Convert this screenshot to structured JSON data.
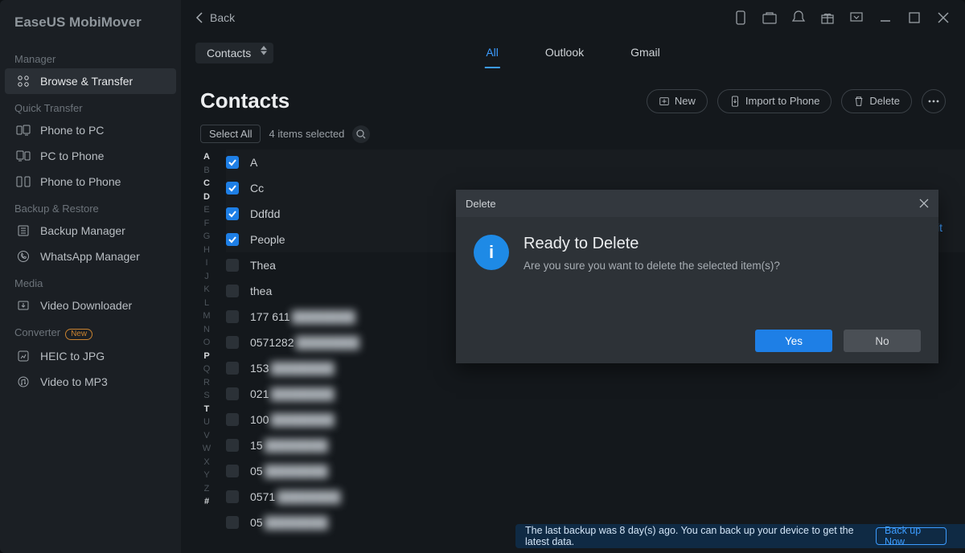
{
  "logo": "EaseUS MobiMover",
  "sidebar_sections": [
    {
      "title": "Manager",
      "items": [
        {
          "icon": "grid",
          "label": "Browse & Transfer",
          "active": true
        }
      ]
    },
    {
      "title": "Quick Transfer",
      "items": [
        {
          "icon": "phone-pc",
          "label": "Phone to PC"
        },
        {
          "icon": "pc-phone",
          "label": "PC to Phone"
        },
        {
          "icon": "phone-phone",
          "label": "Phone to Phone"
        }
      ]
    },
    {
      "title": "Backup & Restore",
      "items": [
        {
          "icon": "backup",
          "label": "Backup Manager"
        },
        {
          "icon": "whatsapp",
          "label": "WhatsApp Manager"
        }
      ]
    },
    {
      "title": "Media",
      "items": [
        {
          "icon": "download",
          "label": "Video Downloader"
        }
      ]
    },
    {
      "title": "Converter",
      "badge": "New",
      "items": [
        {
          "icon": "heic",
          "label": "HEIC to JPG"
        },
        {
          "icon": "mp3",
          "label": "Video to MP3"
        }
      ]
    }
  ],
  "back_label": "Back",
  "category_select": "Contacts",
  "tabs": [
    {
      "label": "All",
      "active": true
    },
    {
      "label": "Outlook"
    },
    {
      "label": "Gmail"
    }
  ],
  "page_title": "Contacts",
  "header_buttons": {
    "new": "New",
    "import": "Import to Phone",
    "delete": "Delete"
  },
  "select_all": "Select All",
  "selected_count": "4 items selected",
  "edit_label": "Edit",
  "contacts": [
    {
      "name": "A",
      "checked": true
    },
    {
      "name": "Cc",
      "checked": true
    },
    {
      "name": "Ddfdd",
      "checked": true
    },
    {
      "name": "People",
      "checked": true
    },
    {
      "name": "Thea",
      "checked": false
    },
    {
      "name": "thea",
      "checked": false
    },
    {
      "name": "177 611",
      "checked": false,
      "blurTail": ""
    },
    {
      "name": "0571282",
      "checked": false,
      "blurTail": "······"
    },
    {
      "name": "153",
      "checked": false,
      "blurTail": "·············"
    },
    {
      "name": "021",
      "checked": false,
      "blurTail": "·············"
    },
    {
      "name": "100",
      "checked": false,
      "blurTail": "··················"
    },
    {
      "name": "15",
      "checked": false,
      "blurTail": "··················"
    },
    {
      "name": "05",
      "checked": false,
      "blurTail": "··················"
    },
    {
      "name": "0571",
      "checked": false,
      "blurTail": "·············"
    },
    {
      "name": "05",
      "checked": false,
      "blurTail": "··················"
    }
  ],
  "alpha_index": [
    "A",
    "B",
    "C",
    "D",
    "E",
    "F",
    "G",
    "H",
    "I",
    "J",
    "K",
    "L",
    "M",
    "N",
    "O",
    "P",
    "Q",
    "R",
    "S",
    "T",
    "U",
    "V",
    "W",
    "X",
    "Y",
    "Z",
    "#"
  ],
  "alpha_highlight": [
    "A",
    "C",
    "D",
    "P",
    "T",
    "#"
  ],
  "modal": {
    "title": "Delete",
    "heading": "Ready to Delete",
    "message": "Are you sure you want to delete the selected item(s)?",
    "yes": "Yes",
    "no": "No"
  },
  "banner": {
    "text": "The last backup was 8 day(s) ago. You can back up your device to get the latest data.",
    "action": "Back up Now"
  }
}
